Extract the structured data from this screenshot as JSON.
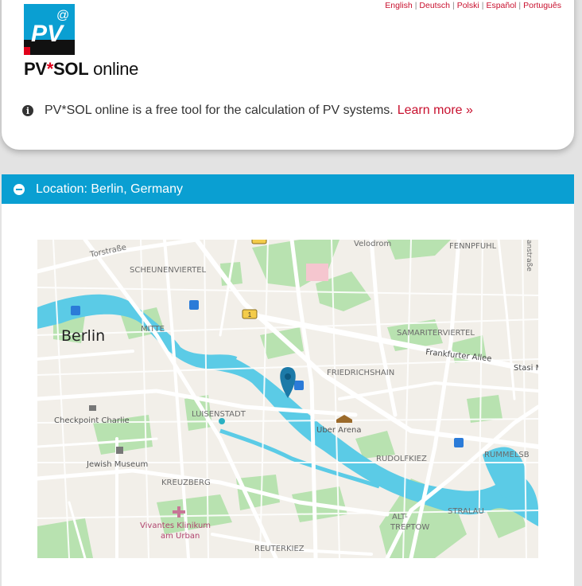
{
  "header": {
    "logo_text": "PV",
    "logo_at": "@",
    "brand_pv": "PV",
    "brand_star": "*",
    "brand_sol": "SOL",
    "brand_online": "online",
    "languages": [
      "English",
      "Deutsch",
      "Polski",
      "Español",
      "Português"
    ],
    "info_text": "PV*SOL online is a free tool for the calculation of PV systems.",
    "learn_more": "Learn more »"
  },
  "location": {
    "label": "Location: Berlin, Germany"
  },
  "map": {
    "labels": {
      "berlin": "Berlin",
      "torstrasse": "Torstraße",
      "scheunenviertel": "SCHEUNENVIERTEL",
      "mitte": "MITTE",
      "velodrom": "Velodrom",
      "fennpfuhl": "FENNPFUHL",
      "anstrasse": "anstraße",
      "samariterviertel": "SAMARITERVIERTEL",
      "frankfurter_allee": "Frankfurter Allee",
      "stasi": "Stasi M",
      "friedrichshain": "FRIEDRICHSHAIN",
      "checkpoint": "Checkpoint Charlie",
      "luisenstadt": "LUISENSTADT",
      "uber_arena": "Uber Arena",
      "jewish_museum": "Jewish Museum",
      "rudolfkiez": "RUDOLFKIEZ",
      "rummelsb": "RUMMELSB",
      "kreuzberg": "KREUZBERG",
      "stralau": "STRALAU",
      "vivantes1": "Vivantes Klinikum",
      "vivantes2": "am Urban",
      "alt_treptow1": "ALT-",
      "alt_treptow2": "TREPTOW",
      "reuterkiez": "REUTERKIEZ",
      "road_shield": "1"
    },
    "colors": {
      "land": "#f2efe9",
      "water": "#5bcbe6",
      "park": "#b8e2b0",
      "road": "#ffffff",
      "pin": "#1c7aa8"
    }
  }
}
